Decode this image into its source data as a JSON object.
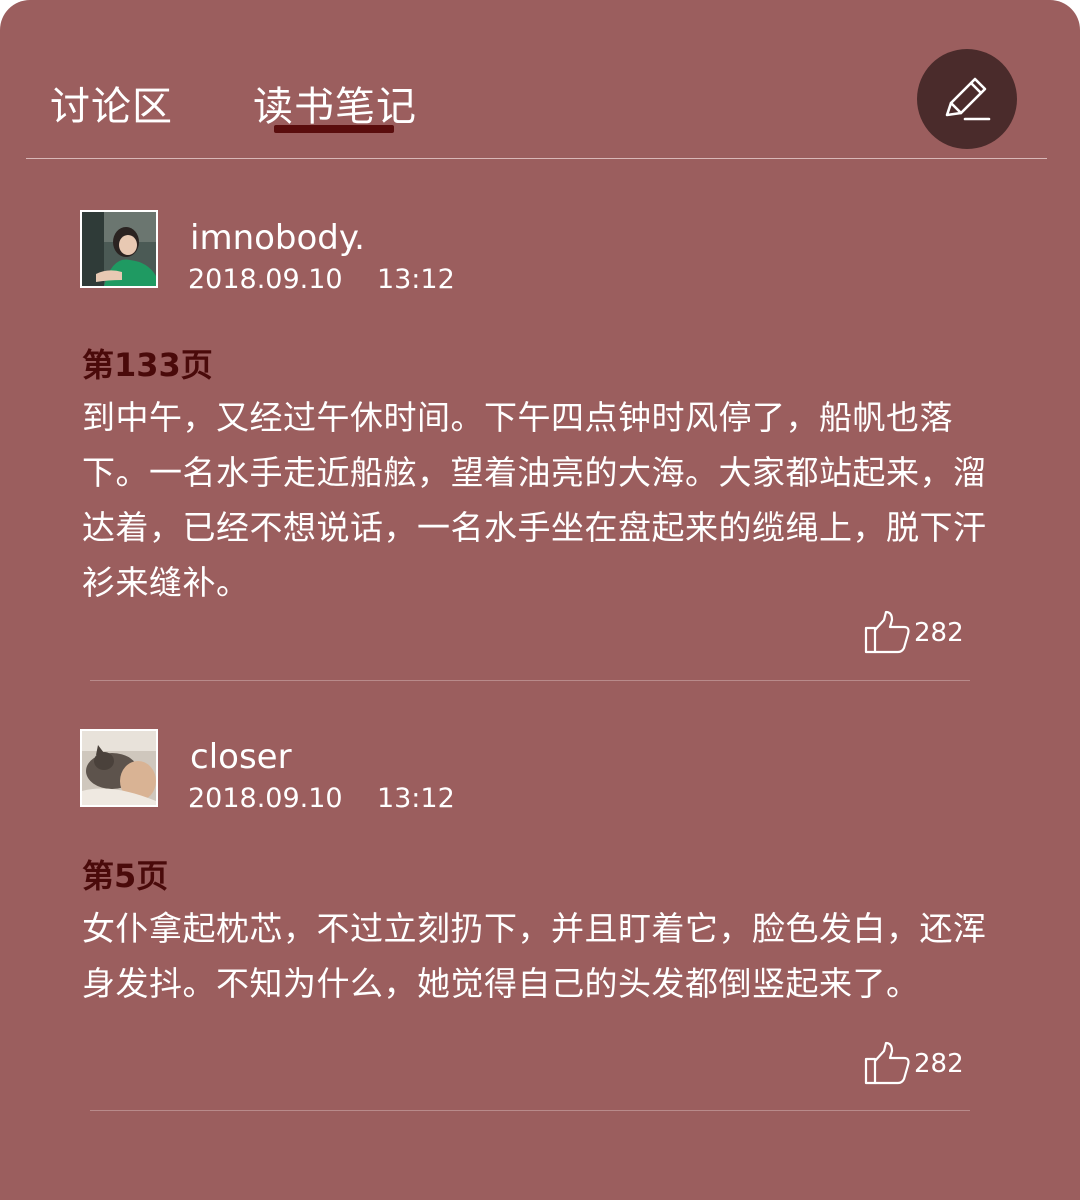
{
  "tabs": [
    {
      "label": "讨论区",
      "active": false
    },
    {
      "label": "读书笔记",
      "active": true
    }
  ],
  "edit_button": {
    "icon": "pencil-icon"
  },
  "notes": [
    {
      "username": "imnobody.",
      "date": "2018.09.10",
      "time": "13:12",
      "page": "第133页",
      "text": "到中午，又经过午休时间。下午四点钟时风停了，船帆也落下。一名水手走近船舷，望着油亮的大海。大家都站起来，溜达着，已经不想说话，一名水手坐在盘起来的缆绳上，脱下汗衫来缝补。",
      "likes": "282"
    },
    {
      "username": "closer",
      "date": "2018.09.10",
      "time": "13:12",
      "page": "第5页",
      "text": "女仆拿起枕芯，不过立刻扔下，并且盯着它，脸色发白，还浑身发抖。不知为什么，她觉得自己的头发都倒竖起来了。",
      "likes": "282"
    }
  ],
  "colors": {
    "background": "#9b5e5e",
    "accent": "#5a0d0d",
    "edit_button": "#4a2b2b",
    "text": "#ffffff"
  }
}
